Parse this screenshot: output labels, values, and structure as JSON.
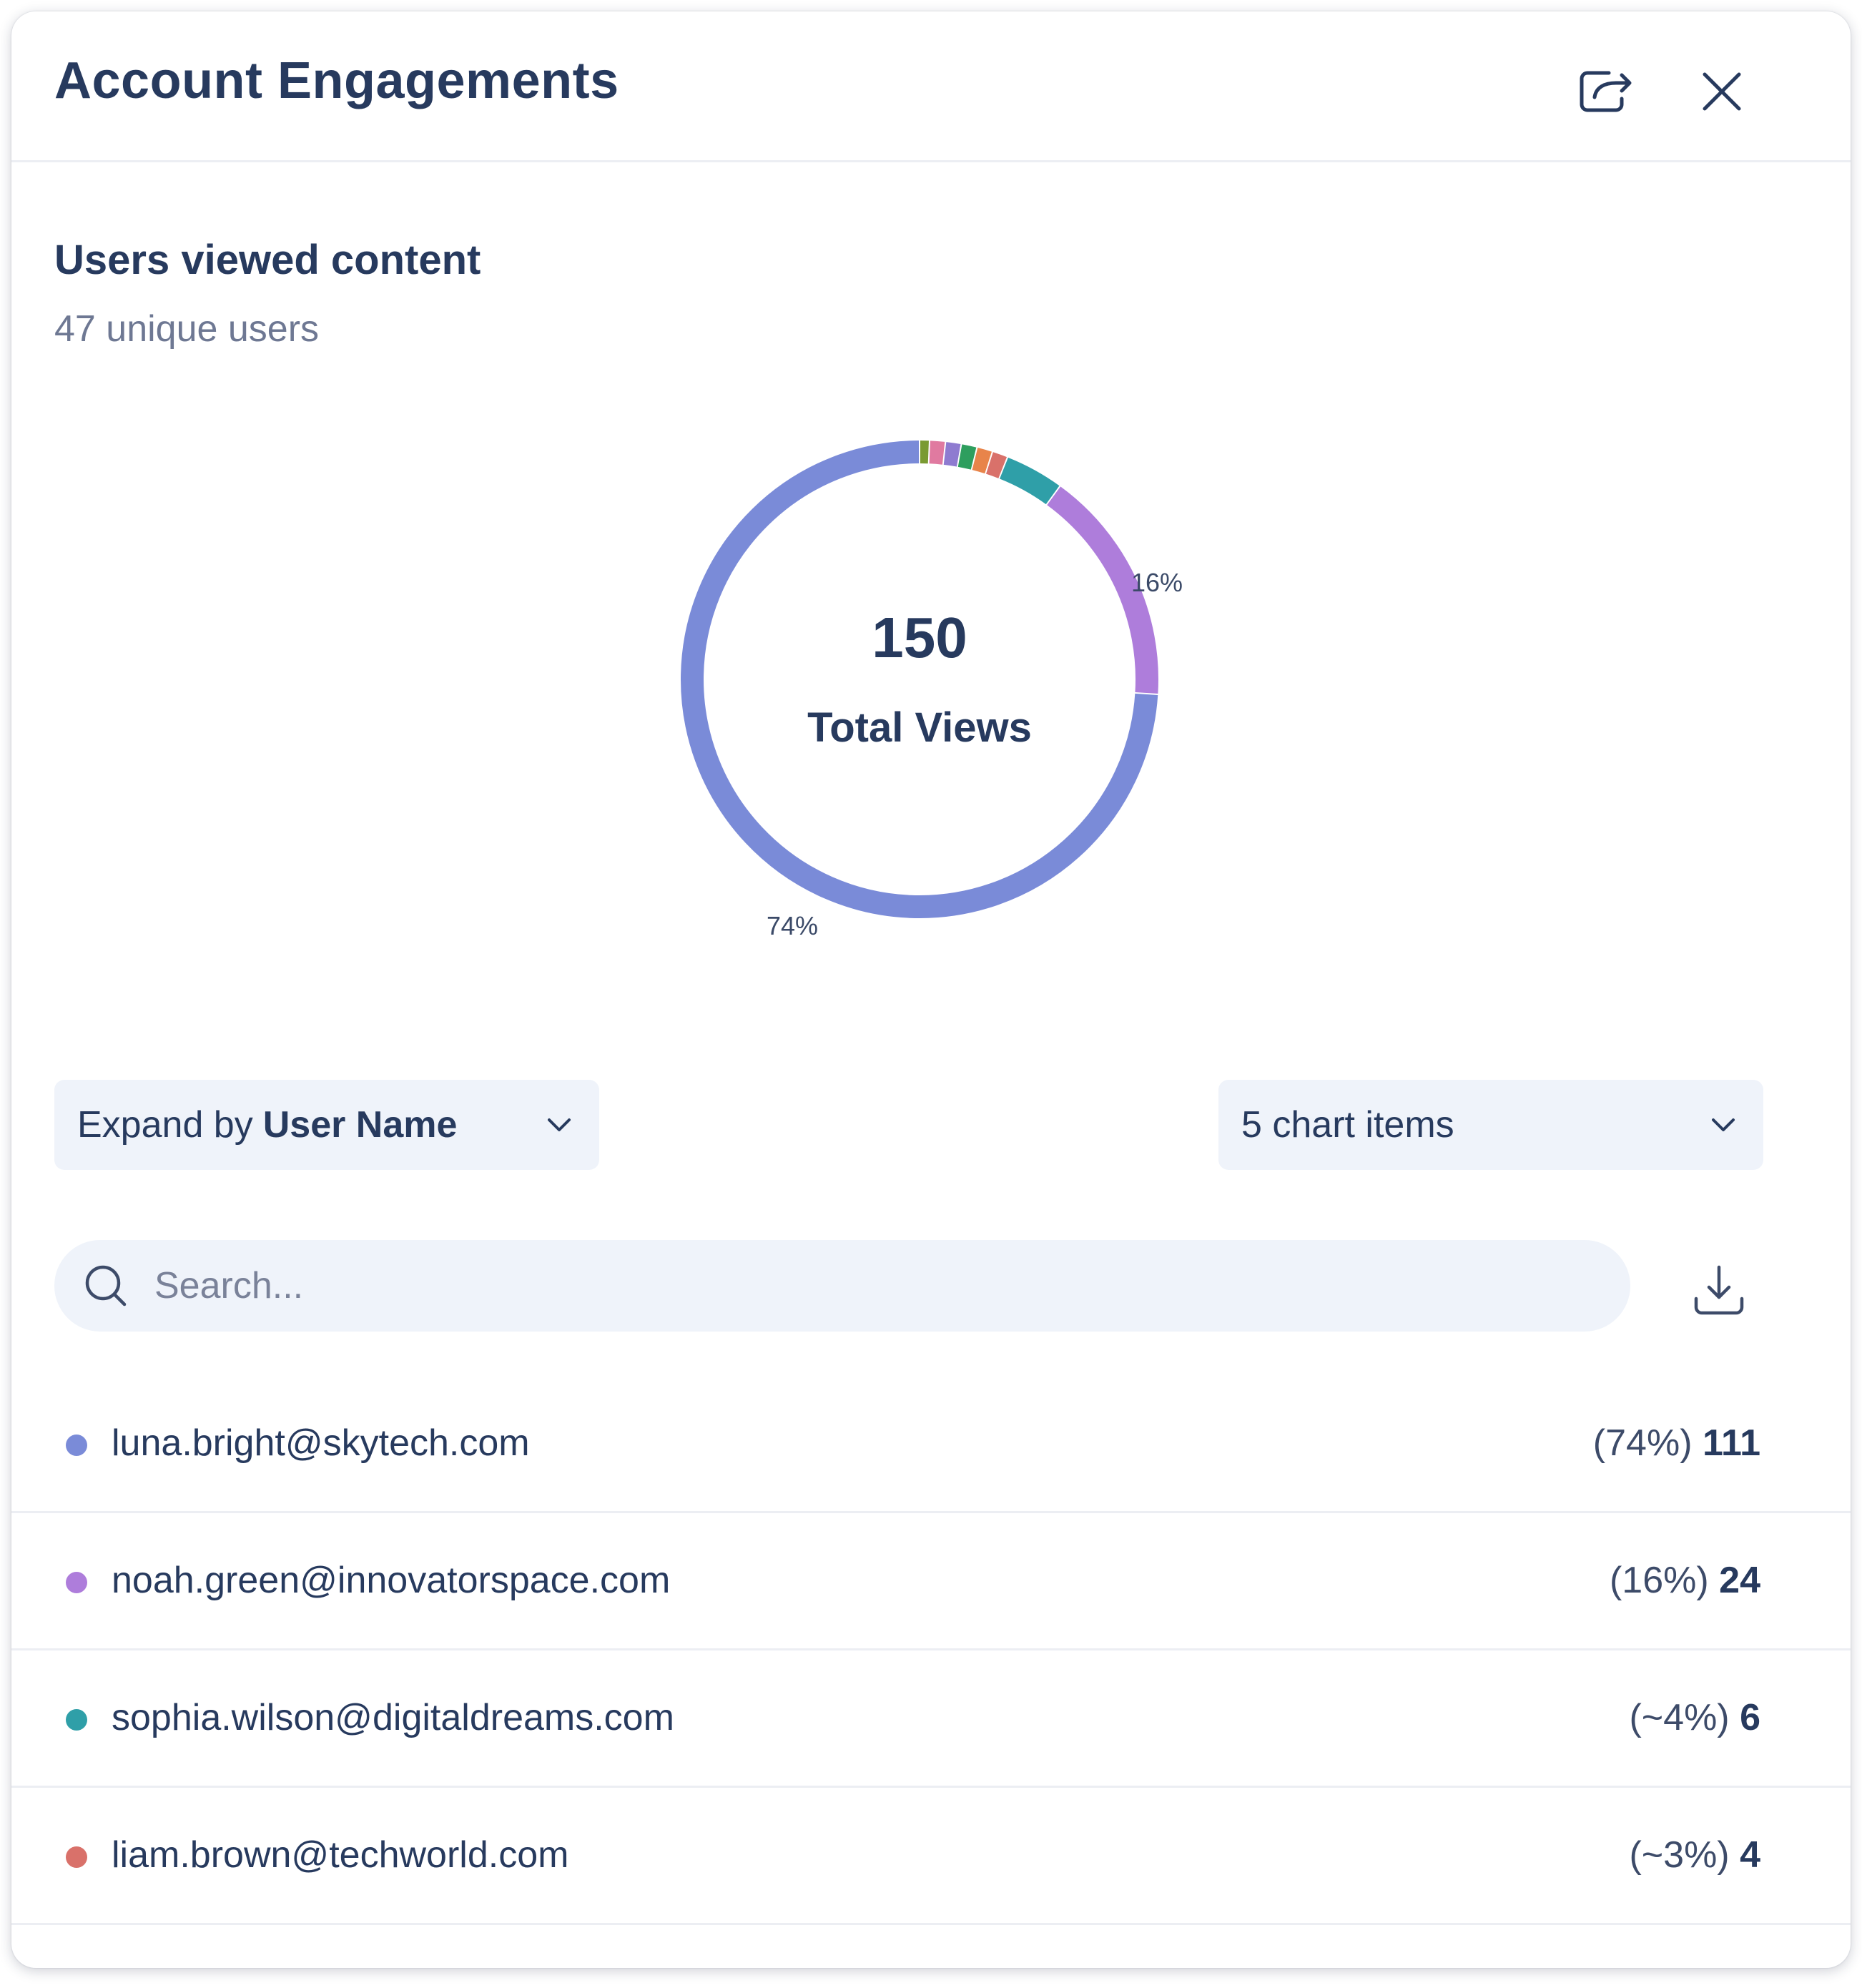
{
  "header": {
    "title": "Account Engagements",
    "share_icon": "share-export-icon",
    "close_icon": "close-icon"
  },
  "section": {
    "title": "Users viewed content",
    "subtitle": "47 unique users"
  },
  "chart_data": {
    "type": "pie",
    "title": "",
    "center_value": "150",
    "center_label": "Total Views",
    "slices": [
      {
        "value": 111,
        "color": "#7a8bd8",
        "label": "74%"
      },
      {
        "value": 24,
        "color": "#ae7ddb",
        "label": "16%"
      },
      {
        "value": 6,
        "color": "#2f9fa8",
        "label": ""
      },
      {
        "value": 1.6,
        "color": "#d9716a",
        "label": ""
      },
      {
        "value": 1.6,
        "color": "#e8844a",
        "label": ""
      },
      {
        "value": 1.6,
        "color": "#2e9e5e",
        "label": ""
      },
      {
        "value": 1.6,
        "color": "#8e7bd0",
        "label": ""
      },
      {
        "value": 1.6,
        "color": "#e07aa0",
        "label": ""
      },
      {
        "value": 1.0,
        "color": "#7a9a32",
        "label": ""
      }
    ]
  },
  "controls": {
    "expand_prefix": "Expand by",
    "expand_value": "User Name",
    "chart_items": "5 chart items",
    "search_placeholder": "Search...",
    "download_icon": "download-icon"
  },
  "rows": [
    {
      "email": "luna.bright@skytech.com",
      "pct": "(74%)",
      "count": "111",
      "color": "#7a8bd8"
    },
    {
      "email": "noah.green@innovatorspace.com",
      "pct": "(16%)",
      "count": "24",
      "color": "#ae7ddb"
    },
    {
      "email": "sophia.wilson@digitaldreams.com",
      "pct": "(~4%)",
      "count": "6",
      "color": "#2f9fa8"
    },
    {
      "email": "liam.brown@techworld.com",
      "pct": "(~3%)",
      "count": "4",
      "color": "#d9716a"
    }
  ]
}
